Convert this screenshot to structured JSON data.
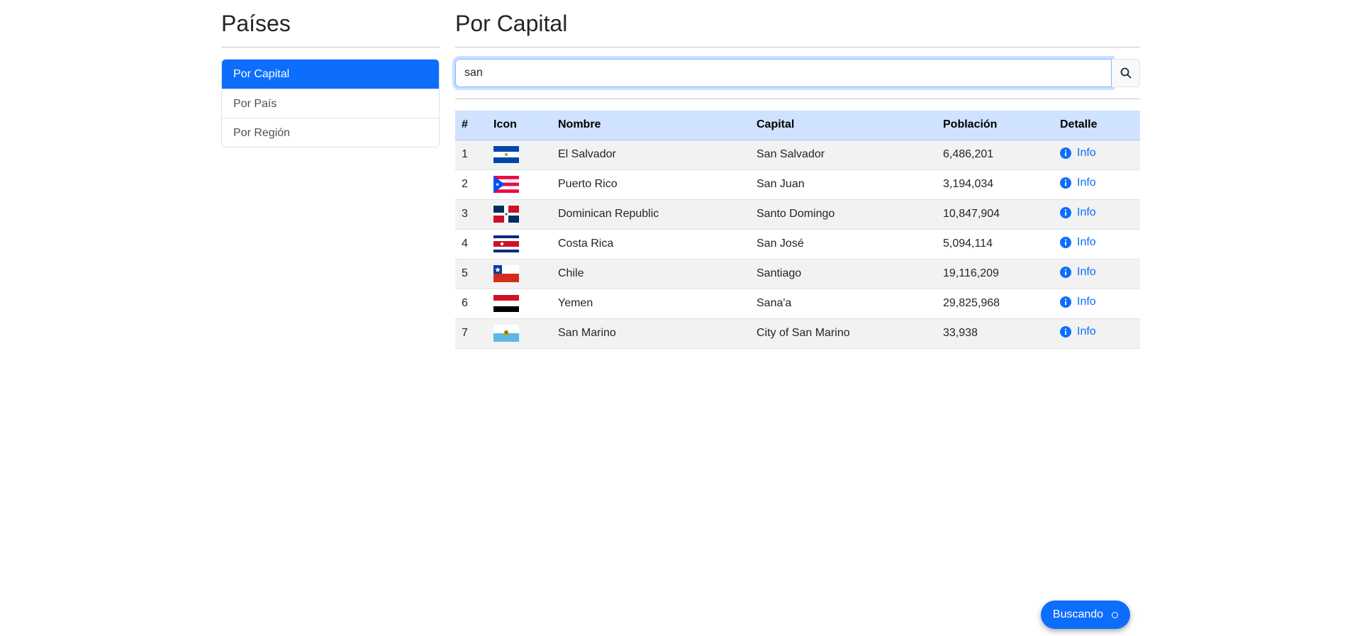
{
  "sidebar": {
    "title": "Países",
    "items": [
      {
        "label": "Por Capital",
        "active": true
      },
      {
        "label": "Por País",
        "active": false
      },
      {
        "label": "Por Región",
        "active": false
      }
    ]
  },
  "main": {
    "title": "Por Capital",
    "search": {
      "value": "san",
      "button_icon": "search-icon"
    },
    "table": {
      "headers": [
        "#",
        "Icon",
        "Nombre",
        "Capital",
        "Población",
        "Detalle"
      ],
      "info_label": "Info",
      "rows": [
        {
          "num": "1",
          "flag": "el-salvador-flag",
          "nombre": "El Salvador",
          "capital": "San Salvador",
          "poblacion": "6,486,201"
        },
        {
          "num": "2",
          "flag": "puerto-rico-flag",
          "nombre": "Puerto Rico",
          "capital": "San Juan",
          "poblacion": "3,194,034"
        },
        {
          "num": "3",
          "flag": "dominican-republic-flag",
          "nombre": "Dominican Republic",
          "capital": "Santo Domingo",
          "poblacion": "10,847,904"
        },
        {
          "num": "4",
          "flag": "costa-rica-flag",
          "nombre": "Costa Rica",
          "capital": "San José",
          "poblacion": "5,094,114"
        },
        {
          "num": "5",
          "flag": "chile-flag",
          "nombre": "Chile",
          "capital": "Santiago",
          "poblacion": "19,116,209"
        },
        {
          "num": "6",
          "flag": "yemen-flag",
          "nombre": "Yemen",
          "capital": "Sana'a",
          "poblacion": "29,825,968"
        },
        {
          "num": "7",
          "flag": "san-marino-flag",
          "nombre": "San Marino",
          "capital": "City of San Marino",
          "poblacion": "33,938"
        }
      ]
    }
  },
  "loading": {
    "label": "Buscando"
  },
  "colors": {
    "primary": "#0d6efd",
    "table_header": "#cfe2ff",
    "striped_row": "#f2f2f2"
  }
}
